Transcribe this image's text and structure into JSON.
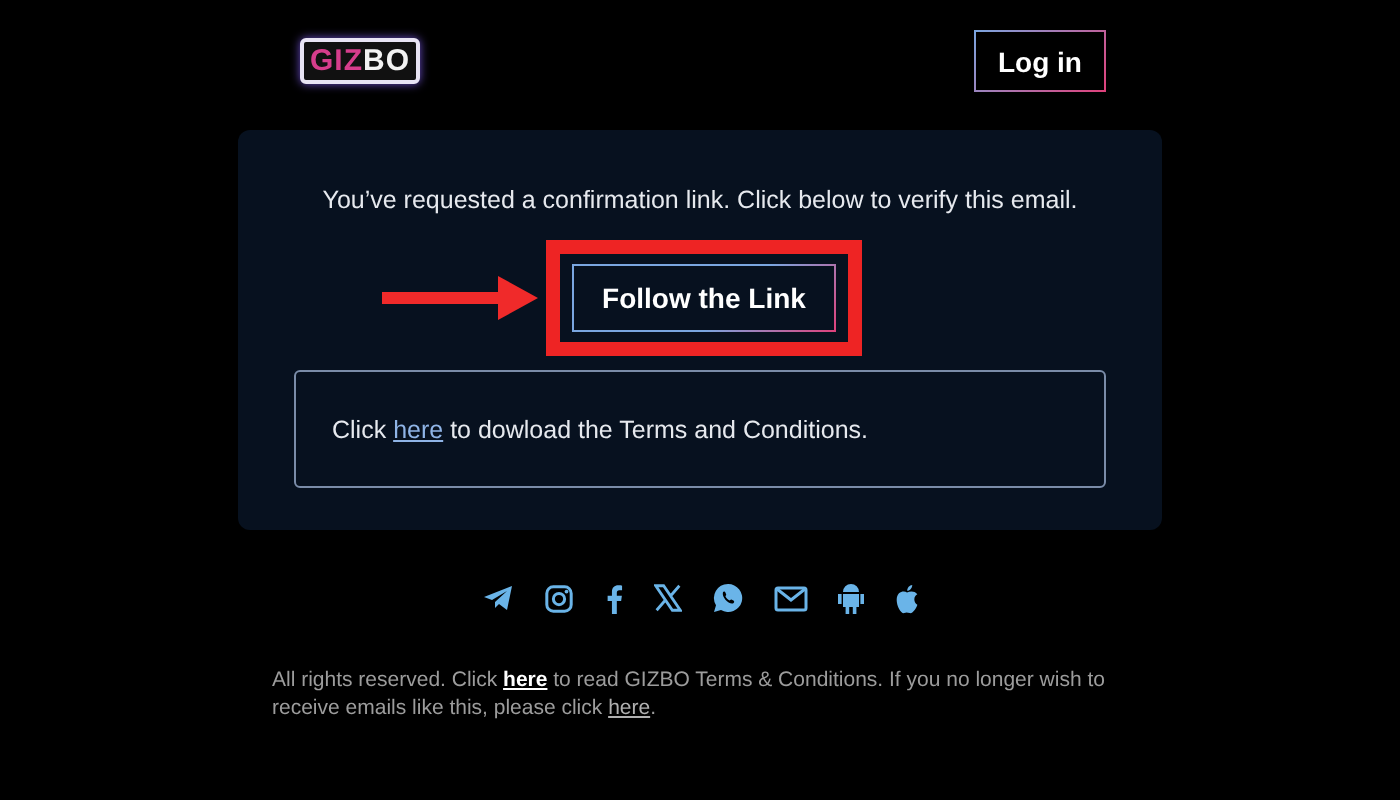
{
  "header": {
    "logo_accent": "GIZ",
    "logo_rest": "BO",
    "login_button": "Log in"
  },
  "card": {
    "message": "You’ve requested a confirmation link. Click below to verify this email.",
    "action_button": "Follow the Link",
    "notice": [
      {
        "kind": "text",
        "text": "Click "
      },
      {
        "kind": "link",
        "text": "here"
      },
      {
        "kind": "text",
        "text": " to dowload the Terms and Conditions."
      }
    ]
  },
  "social_icons": [
    {
      "kind": "telegram"
    },
    {
      "kind": "instagram"
    },
    {
      "kind": "facebook"
    },
    {
      "kind": "x"
    },
    {
      "kind": "whatsapp"
    },
    {
      "kind": "mail"
    },
    {
      "kind": "android"
    },
    {
      "kind": "apple"
    }
  ],
  "footer": [
    {
      "kind": "text",
      "text": "All rights reserved. Click "
    },
    {
      "kind": "strong-link",
      "text": "here"
    },
    {
      "kind": "text",
      "text": " to read GIZBO Terms & Conditions. If you no longer wish to receive emails like this, please click "
    },
    {
      "kind": "link",
      "text": "here"
    },
    {
      "kind": "text",
      "text": "."
    }
  ]
}
